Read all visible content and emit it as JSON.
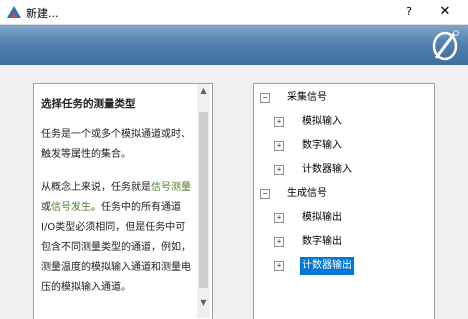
{
  "window": {
    "title": "新建...",
    "help_label": "?",
    "close_label": "✕"
  },
  "description": {
    "heading": "选择任务的测量类型",
    "para1": "任务是一个或多个模拟通道或时、触发等属性的集合。",
    "para2_lines": [
      [
        "从概念上来说，任务就是",
        "信号测量"
      ],
      [
        "或",
        "信号发生",
        "。任务中的所有通道"
      ],
      [
        "I/O类型必须相同，但是任务中可"
      ],
      [
        "包含不同测量类型的通道，例如，"
      ],
      [
        "测量温度的模拟输入通道和测量电"
      ],
      [
        "压的模拟输入通道。"
      ]
    ]
  },
  "tree": {
    "groups": [
      {
        "label": "采集信号",
        "expander": "−",
        "children": [
          {
            "label": "模拟输入",
            "expander": "+"
          },
          {
            "label": "数字输入",
            "expander": "+"
          },
          {
            "label": "计数器输入",
            "expander": "+"
          }
        ]
      },
      {
        "label": "生成信号",
        "expander": "−",
        "children": [
          {
            "label": "模拟输出",
            "expander": "+"
          },
          {
            "label": "数字输出",
            "expander": "+"
          },
          {
            "label": "计数器输出",
            "expander": "+",
            "selected": true
          }
        ]
      }
    ]
  },
  "colors": {
    "header_blue": "#4e7fae",
    "selection": "#0078d7",
    "link_green": "#4f7f2a"
  }
}
